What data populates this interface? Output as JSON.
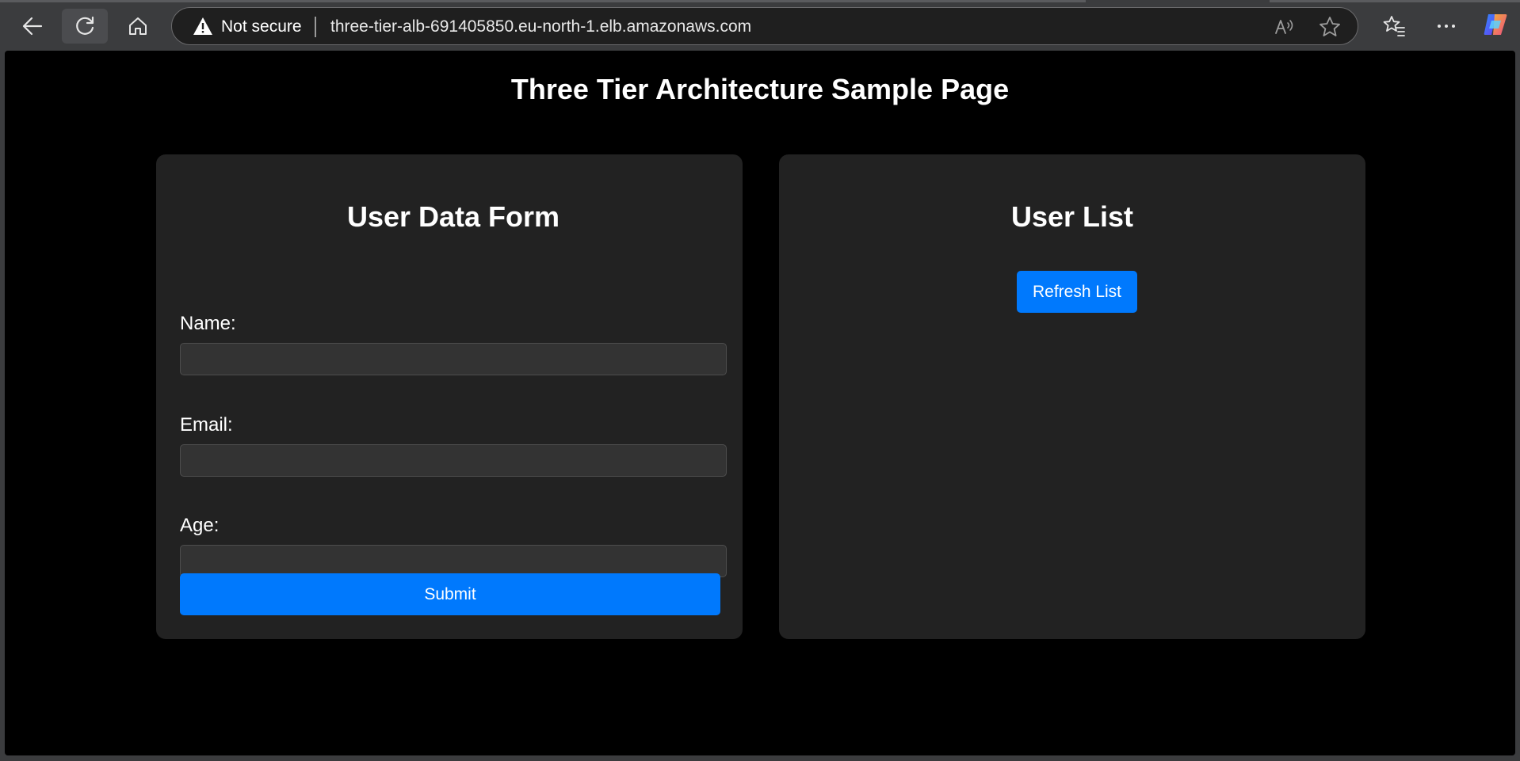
{
  "browser": {
    "security_label": "Not secure",
    "url": "three-tier-alb-691405850.eu-north-1.elb.amazonaws.com",
    "icons": [
      "back-icon",
      "reload-icon",
      "home-icon",
      "warning-icon",
      "read-aloud-icon",
      "favorite-star-icon",
      "favorites-icon",
      "more-icon",
      "copilot-icon"
    ]
  },
  "page": {
    "title": "Three Tier Architecture Sample Page"
  },
  "form": {
    "heading": "User Data Form",
    "fields": [
      {
        "label": "Name:",
        "value": ""
      },
      {
        "label": "Email:",
        "value": ""
      },
      {
        "label": "Age:",
        "value": ""
      }
    ],
    "submit_label": "Submit"
  },
  "user_list": {
    "heading": "User List",
    "refresh_label": "Refresh List"
  },
  "colors": {
    "page_bg": "#000000",
    "card_bg": "#222222",
    "input_bg": "#333333",
    "accent": "#0079fd",
    "chrome_bg": "#3b3c3e"
  }
}
